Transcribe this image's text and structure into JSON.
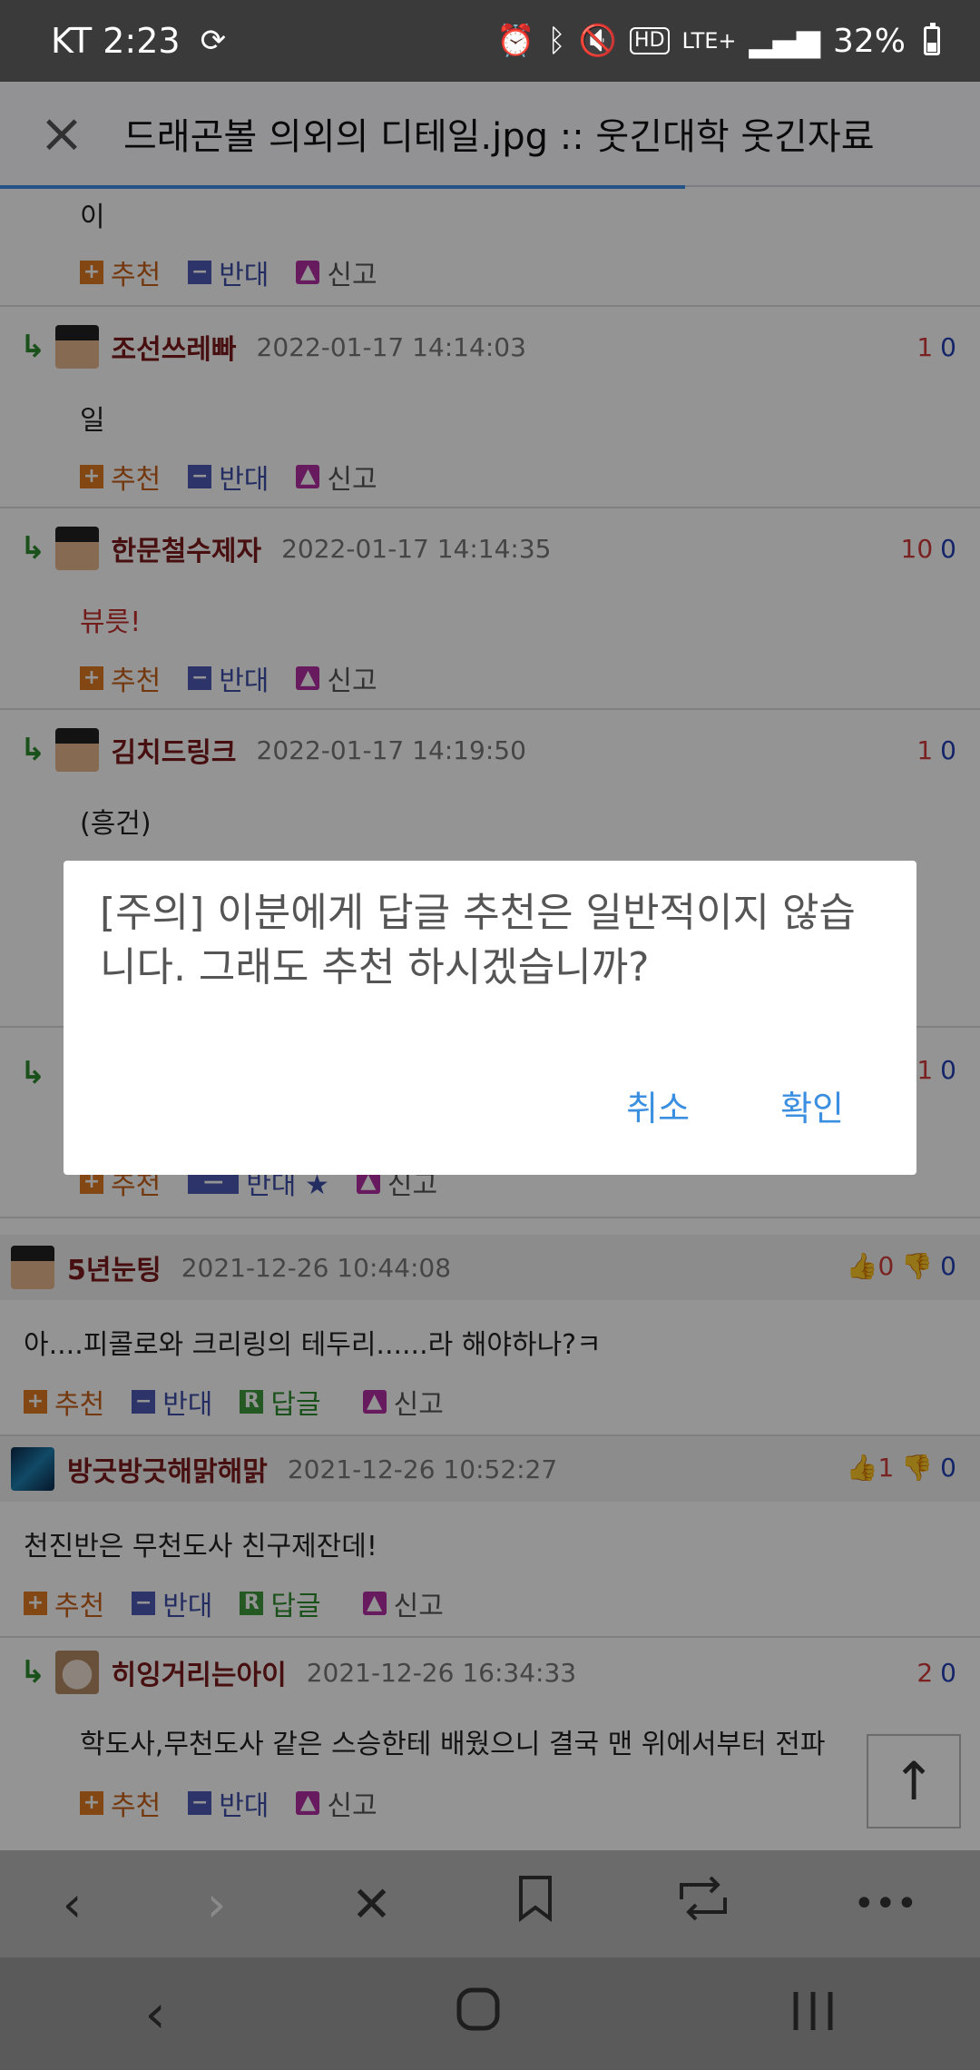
{
  "status_bar": {
    "carrier_time": "KT 2:23",
    "battery": "32%",
    "network": "LTE+"
  },
  "header": {
    "title": "드래곤볼 의외의 디테일.jpg :: 웃긴대학 웃긴자료",
    "close_label": "×"
  },
  "labels": {
    "recommend": "추천",
    "oppose": "반대",
    "reply": "답글",
    "report": "신고",
    "oppose_star": "반대 ★"
  },
  "comments": [
    {
      "nick": "",
      "date": "",
      "text": "이",
      "up": "",
      "down": ""
    },
    {
      "nick": "조선쓰레빠",
      "date": "2022-01-17 14:14:03",
      "text": "일",
      "up": "1",
      "down": "0"
    },
    {
      "nick": "한문철수제자",
      "date": "2022-01-17 14:14:35",
      "text": "뷰릇!",
      "up": "10",
      "down": "0"
    },
    {
      "nick": "김치드링크",
      "date": "2022-01-17 14:19:50",
      "text": "(흥건)",
      "up": "1",
      "down": "0"
    },
    {
      "nick": "",
      "date": "",
      "text": "",
      "up": "1",
      "down": "0"
    },
    {
      "nick": "5년눈팅",
      "date": "2021-12-26 10:44:08",
      "text": "아....피콜로와 크리링의 테두리......라 해야하나?ㅋ",
      "up": "0",
      "down": "0"
    },
    {
      "nick": "방긋방긋해맑해맑",
      "date": "2021-12-26 10:52:27",
      "text": "천진반은 무천도사 친구제잔데!",
      "up": "1",
      "down": "0"
    },
    {
      "nick": "히잉거리는아이",
      "date": "2021-12-26 16:34:33",
      "text": "학도사,무천도사 같은 스승한테 배웠으니 결국 맨 위에서부터 전파",
      "up": "2",
      "down": "0"
    }
  ],
  "dialog": {
    "message": "[주의] 이분에게 답글 추천은 일반적이지 않습니다. 그래도 추천 하시겠습니까?",
    "cancel": "취소",
    "confirm": "확인"
  },
  "toolbar": {
    "back": "‹",
    "forward": "›",
    "close": "✕",
    "bookmark": "bookmark",
    "share": "share",
    "more": "•••"
  },
  "navbar": {
    "back": "‹",
    "home": "home",
    "recents": "recents"
  }
}
